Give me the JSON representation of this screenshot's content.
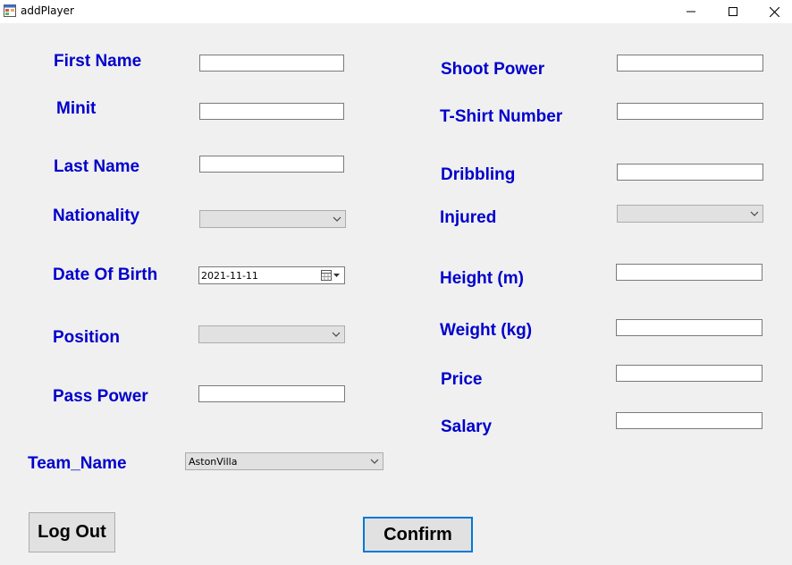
{
  "window": {
    "title": "addPlayer",
    "icons": {
      "app": "app-form-icon",
      "minimize": "minimize-icon",
      "maximize": "maximize-icon",
      "close": "close-icon"
    }
  },
  "form": {
    "labels": {
      "first_name": "First Name",
      "minit": "Minit",
      "last_name": "Last Name",
      "nationality": "Nationality",
      "date_of_birth": "Date Of Birth",
      "position": "Position",
      "pass_power": "Pass Power",
      "team_name": "Team_Name",
      "shoot_power": "Shoot Power",
      "tshirt_number": "T-Shirt Number",
      "dribbling": "Dribbling",
      "injured": "Injured",
      "height": "Height (m)",
      "weight": "Weight (kg)",
      "price": "Price",
      "salary": "Salary"
    },
    "values": {
      "first_name": "",
      "minit": "",
      "last_name": "",
      "nationality": "",
      "date_of_birth": "2021-11-11",
      "position": "",
      "pass_power": "",
      "team_name": "AstonVilla",
      "shoot_power": "",
      "tshirt_number": "",
      "dribbling": "",
      "injured": "",
      "height": "",
      "weight": "",
      "price": "",
      "salary": ""
    }
  },
  "buttons": {
    "logout": "Log Out",
    "confirm": "Confirm"
  },
  "colors": {
    "label": "#0000cc",
    "background": "#f0f0f0",
    "accent_border": "#0078d7"
  }
}
